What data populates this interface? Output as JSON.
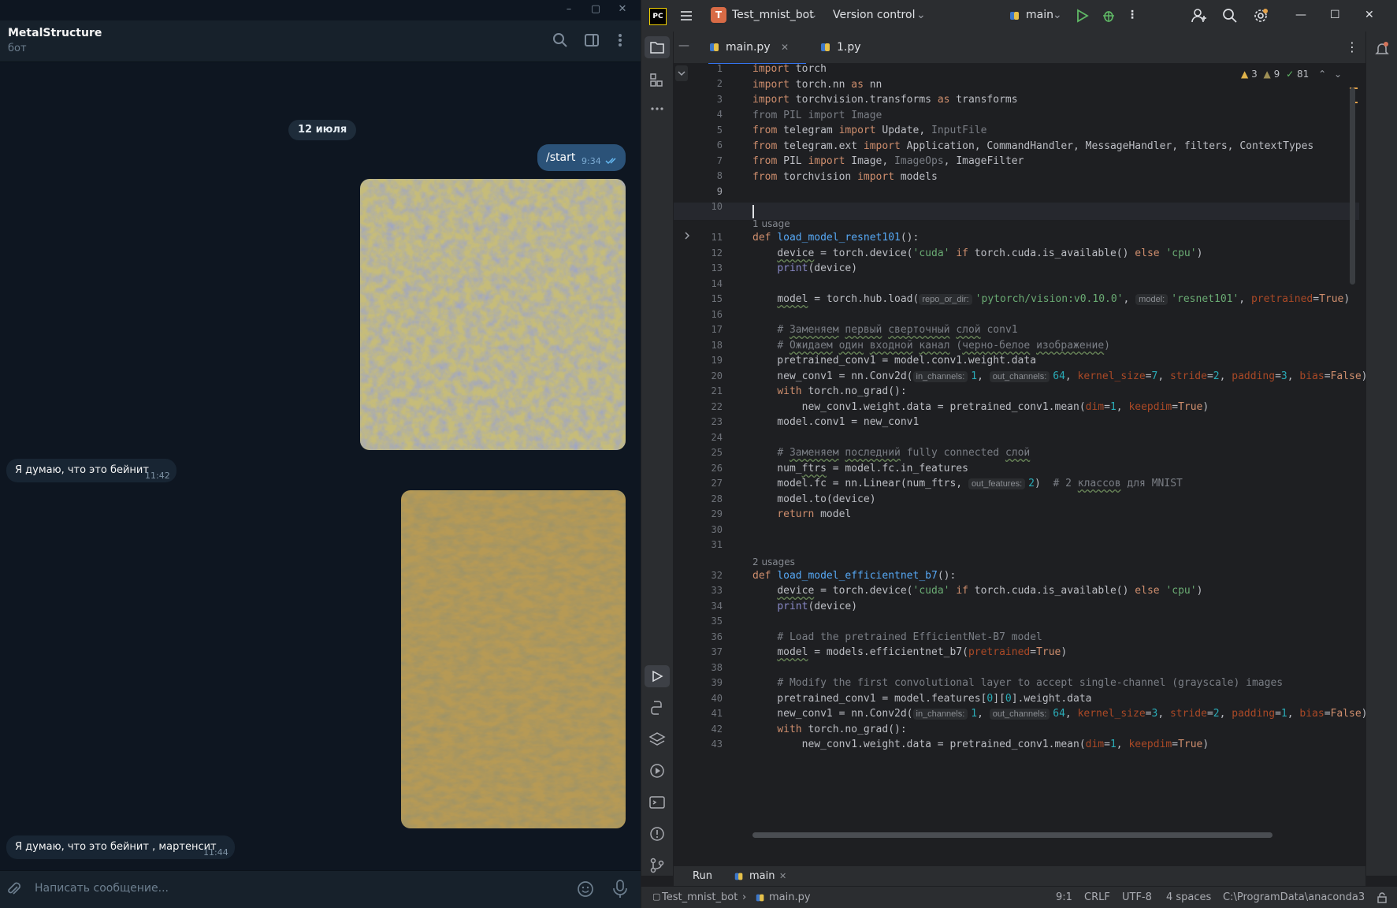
{
  "telegram": {
    "chat_name": "MetalStructure",
    "chat_status": "бот",
    "date_badge": "12 июля",
    "messages": [
      {
        "text": "/start",
        "time": "9:34"
      },
      {
        "text": "Я думаю, что это бейнит",
        "time": "11:42"
      },
      {
        "text": "Я думаю, что это бейнит , мартенсит",
        "time": "11:44"
      }
    ],
    "input_placeholder": "Написать сообщение..."
  },
  "ide": {
    "project_badge": "T",
    "project_name": "Test_mnist_bot",
    "vcs": "Version control",
    "branch": "main",
    "tabs": [
      {
        "label": "main.py",
        "active": true
      },
      {
        "label": "1.py",
        "active": false
      }
    ],
    "inspections": {
      "warnings": "3",
      "weak_warnings": "9",
      "ok": "81"
    },
    "usages_1": "1 usage",
    "usages_2": "2 usages",
    "line_numbers": [
      "1",
      "2",
      "3",
      "4",
      "5",
      "6",
      "7",
      "8",
      "9",
      "10",
      "11",
      "12",
      "13",
      "14",
      "15",
      "16",
      "17",
      "18",
      "19",
      "20",
      "21",
      "22",
      "23",
      "24",
      "25",
      "26",
      "27",
      "28",
      "29",
      "30",
      "31",
      "32",
      "33",
      "34",
      "35",
      "36",
      "37",
      "38",
      "39",
      "40",
      "41",
      "42",
      "43"
    ],
    "hints": {
      "repo_or_dir": "repo_or_dir:",
      "model": "model:",
      "in_channels": "in_channels:",
      "out_channels": "out_channels:",
      "out_features": "out_features:"
    },
    "run_label": "Run",
    "run_tab": "main",
    "status": {
      "breadcrumb_project": "Test_mnist_bot",
      "breadcrumb_file": "main.py",
      "position": "9:1",
      "line_sep": "CRLF",
      "encoding": "UTF-8",
      "indent": "4 spaces",
      "interpreter": "C:\\ProgramData\\anaconda3"
    }
  },
  "colors": {
    "telegram_bg": "#0e1621",
    "bubble_out": "#2b5278",
    "bubble_in": "#182533",
    "ide_bg": "#1e1f22",
    "keyword": "#cf8e6d",
    "string": "#6aab73",
    "number": "#2aacb8",
    "function": "#56a8f5"
  }
}
